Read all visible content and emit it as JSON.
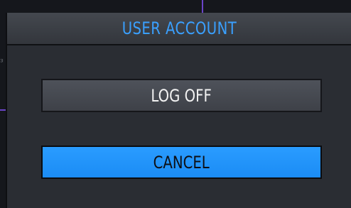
{
  "dialog": {
    "title": "USER ACCOUNT",
    "buttons": {
      "log_off": "LOG OFF",
      "cancel": "CANCEL"
    }
  },
  "colors": {
    "title_accent": "#3aa0ff",
    "cancel_button": "#1e90ff",
    "dialog_background": "#2a2d33"
  }
}
